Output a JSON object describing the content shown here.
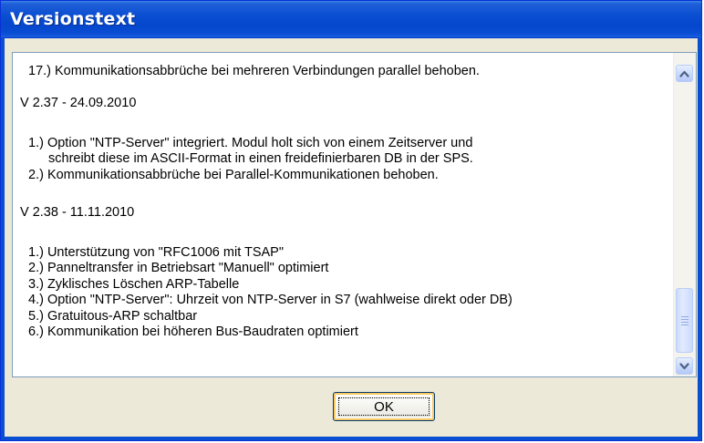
{
  "window": {
    "title": "Versionstext"
  },
  "text": {
    "lines": [
      "17.) Kommunikationsabbrüche bei mehreren Verbindungen parallel behoben.",
      "V 2.37 - 24.09.2010",
      "1.) Option \"NTP-Server\" integriert. Modul holt sich von einem Zeitserver und",
      "schreibt diese im ASCII-Format in einen freidefinierbaren DB in der SPS.",
      "2.) Kommunikationsabbrüche bei Parallel-Kommunikationen behoben.",
      "V 2.38 - 11.11.2010",
      "1.) Unterstützung von \"RFC1006 mit TSAP\"",
      "2.) Panneltransfer in Betriebsart \"Manuell\" optimiert",
      "3.) Zyklisches Löschen ARP-Tabelle",
      "4.) Option \"NTP-Server\": Uhrzeit von NTP-Server in S7 (wahlweise direkt oder DB)",
      "5.) Gratuitous-ARP schaltbar",
      "6.) Kommunikation bei höheren Bus-Baudraten optimiert"
    ]
  },
  "scrollbar": {
    "position_fraction": 0.95,
    "up_icon": "scroll-up-arrow-icon",
    "down_icon": "scroll-down-arrow-icon"
  },
  "buttons": {
    "ok_label": "OK"
  },
  "colors": {
    "titlebar": "#0a4ed1",
    "dialog_background": "#ece9d8",
    "scrollbar_accent": "#4d6185"
  }
}
